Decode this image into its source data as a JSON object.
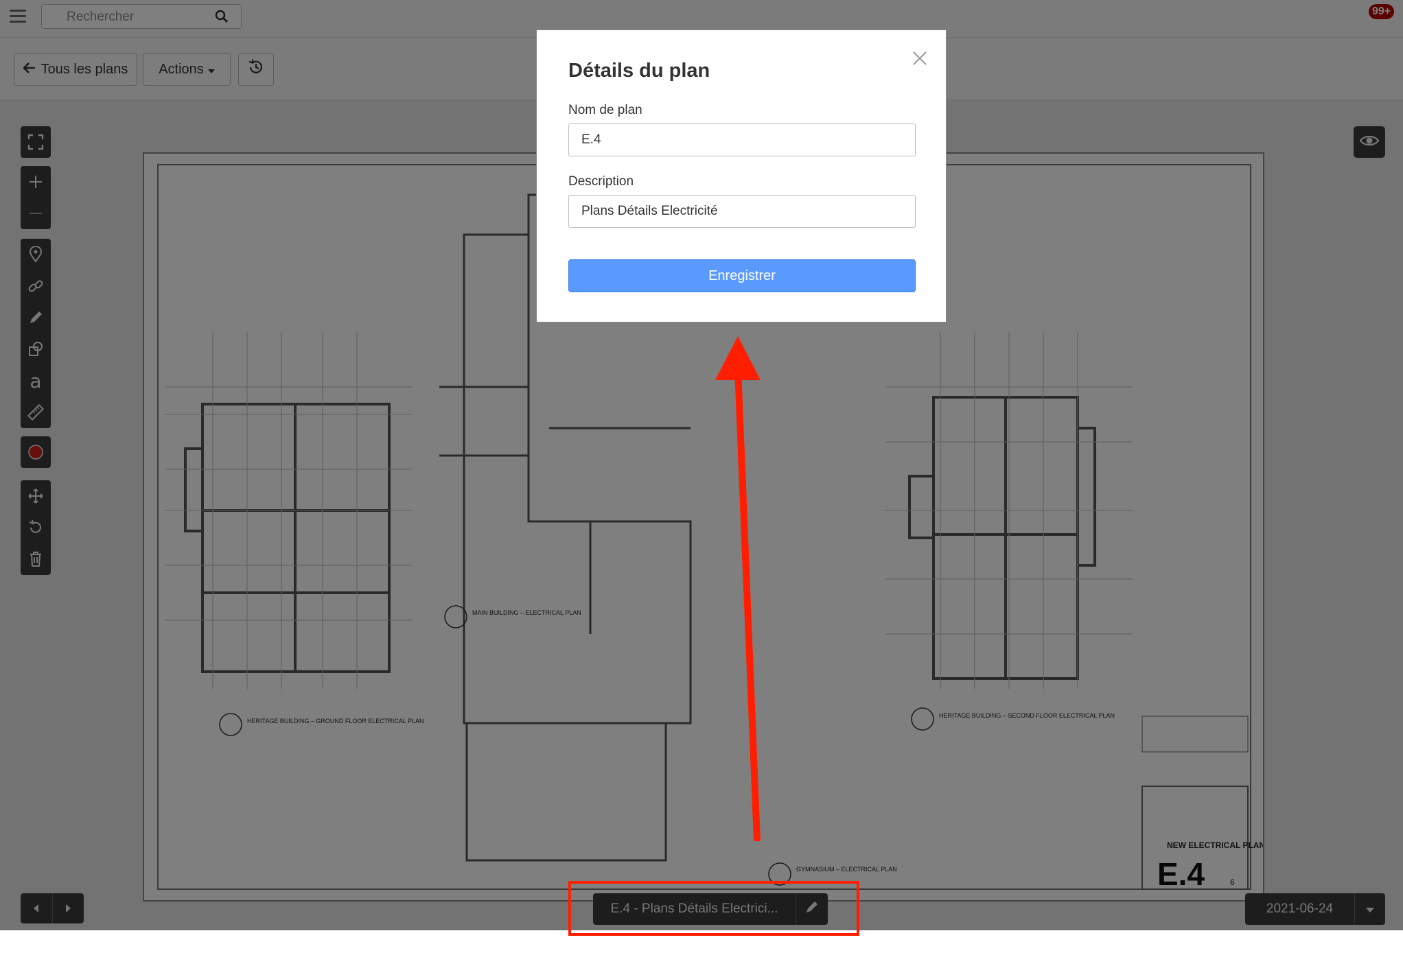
{
  "topbar": {
    "search_placeholder": "Rechercher",
    "notification_count": "99+"
  },
  "toolbar": {
    "back_label": "Tous les plans",
    "actions_label": "Actions"
  },
  "plan_sheet": {
    "labels": [
      "MAIN BUILDING – ELECTRICAL PLAN",
      "HERITAGE BUILDING – GROUND FLOOR ELECTRICAL PLAN",
      "HERITAGE BUILDING – SECOND FLOOR ELECTRICAL PLAN",
      "GYMNASIUM – ELECTRICAL PLAN"
    ],
    "title_block": "NEW ELECTRICAL PLANS",
    "sheet_number": "E.4",
    "page_of": "6"
  },
  "footer": {
    "plan_label": "E.4 - Plans Détails Electrici...",
    "date": "2021-06-24"
  },
  "modal": {
    "title": "Détails du plan",
    "name_label": "Nom de plan",
    "name_value": "E.4",
    "description_label": "Description",
    "description_value": "Plans Détails Electricité",
    "save_label": "Enregistrer"
  },
  "colors": {
    "save_button": "#5a9aff",
    "annotation_red": "#ff1e00",
    "notification": "#b50000"
  }
}
